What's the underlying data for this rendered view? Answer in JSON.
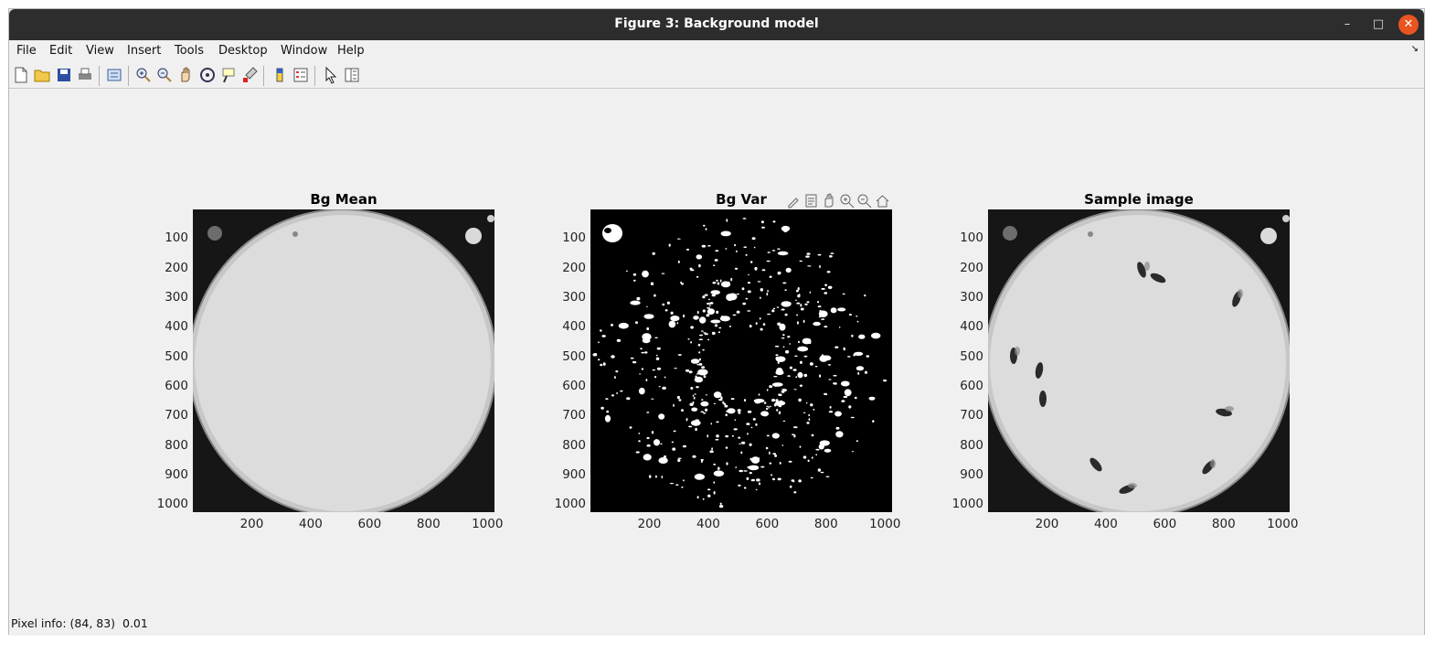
{
  "window": {
    "title": "Figure 3: Background model"
  },
  "menu": [
    "File",
    "Edit",
    "View",
    "Insert",
    "Tools",
    "Desktop",
    "Window",
    "Help"
  ],
  "toolbar_icons": [
    "new-figure-icon",
    "open-file-icon",
    "save-icon",
    "print-icon",
    "link-plot-icon",
    "zoom-in-icon",
    "zoom-out-icon",
    "pan-icon",
    "rotate-3d-icon",
    "data-cursor-icon",
    "brush-icon",
    "colorbar-icon",
    "legend-icon",
    "edit-plot-icon",
    "property-inspector-icon"
  ],
  "axes_toolbar_icons": [
    "brush-icon",
    "data-tips-icon",
    "pan-icon",
    "zoom-in-icon",
    "zoom-out-icon",
    "restore-view-icon"
  ],
  "panels": [
    {
      "title": "Bg Mean"
    },
    {
      "title": "Bg Var"
    },
    {
      "title": "Sample image"
    }
  ],
  "axis_ticks": {
    "y": [
      "100",
      "200",
      "300",
      "400",
      "500",
      "600",
      "700",
      "800",
      "900",
      "1000"
    ],
    "x": [
      "200",
      "400",
      "600",
      "800",
      "1000"
    ]
  },
  "status": {
    "label": "Pixel info:",
    "coords": "(84, 83)",
    "value": "0.01"
  }
}
